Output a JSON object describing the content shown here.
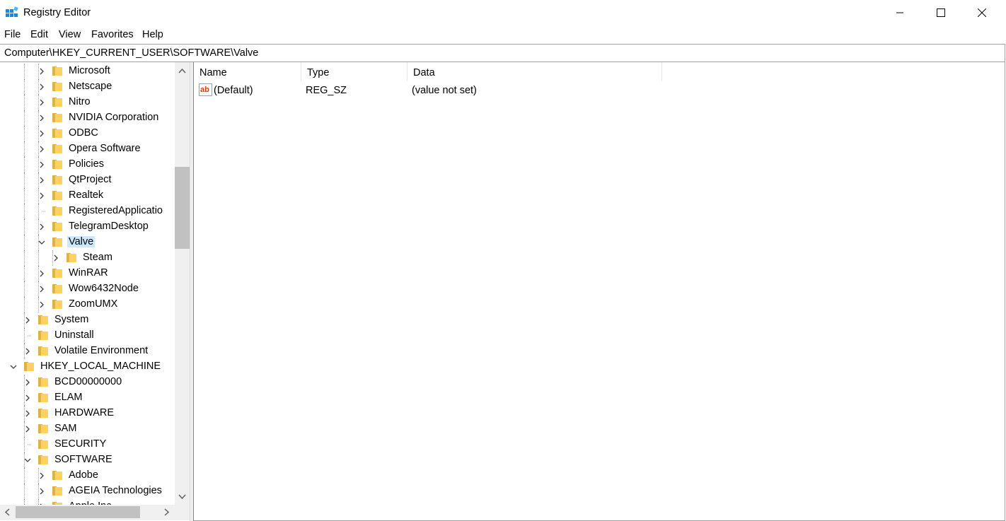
{
  "window": {
    "title": "Registry Editor",
    "icon": "registry-editor-icon",
    "controls": [
      "minimize-icon",
      "maximize-icon",
      "close-icon"
    ]
  },
  "menu": [
    "File",
    "Edit",
    "View",
    "Favorites",
    "Help"
  ],
  "address": "Computer\\HKEY_CURRENT_USER\\SOFTWARE\\Valve",
  "tree": {
    "items": [
      {
        "label": "Microsoft",
        "expander": "collapsed"
      },
      {
        "label": "Netscape",
        "expander": "collapsed"
      },
      {
        "label": "Nitro",
        "expander": "collapsed"
      },
      {
        "label": "NVIDIA Corporation",
        "expander": "collapsed"
      },
      {
        "label": "ODBC",
        "expander": "collapsed"
      },
      {
        "label": "Opera Software",
        "expander": "collapsed"
      },
      {
        "label": "Policies",
        "expander": "collapsed"
      },
      {
        "label": "QtProject",
        "expander": "collapsed"
      },
      {
        "label": "Realtek",
        "expander": "collapsed"
      },
      {
        "label": "RegisteredApplicatio",
        "expander": "none"
      },
      {
        "label": "TelegramDesktop",
        "expander": "collapsed"
      },
      {
        "label": "Valve",
        "expander": "expanded",
        "selected": true
      },
      {
        "label": "Steam",
        "expander": "collapsed"
      },
      {
        "label": "WinRAR",
        "expander": "collapsed"
      },
      {
        "label": "Wow6432Node",
        "expander": "collapsed"
      },
      {
        "label": "ZoomUMX",
        "expander": "collapsed"
      },
      {
        "label": "System",
        "expander": "collapsed"
      },
      {
        "label": "Uninstall",
        "expander": "none"
      },
      {
        "label": "Volatile Environment",
        "expander": "collapsed"
      },
      {
        "label": "HKEY_LOCAL_MACHINE",
        "expander": "expanded"
      },
      {
        "label": "BCD00000000",
        "expander": "collapsed"
      },
      {
        "label": "ELAM",
        "expander": "collapsed"
      },
      {
        "label": "HARDWARE",
        "expander": "collapsed"
      },
      {
        "label": "SAM",
        "expander": "collapsed"
      },
      {
        "label": "SECURITY",
        "expander": "none"
      },
      {
        "label": "SOFTWARE",
        "expander": "expanded"
      },
      {
        "label": "Adobe",
        "expander": "collapsed"
      },
      {
        "label": "AGEIA Technologies",
        "expander": "collapsed"
      },
      {
        "label": "Apple Inc.",
        "expander": "collapsed"
      }
    ]
  },
  "columns": [
    "Name",
    "Type",
    "Data"
  ],
  "values": [
    {
      "name": "(Default)",
      "type": "REG_SZ",
      "data": "(value not set)",
      "icon": "string-value-icon"
    }
  ],
  "colors": {
    "selection": "#cce8ff",
    "folder": "#ffd25f",
    "accent": "#0078d7"
  }
}
